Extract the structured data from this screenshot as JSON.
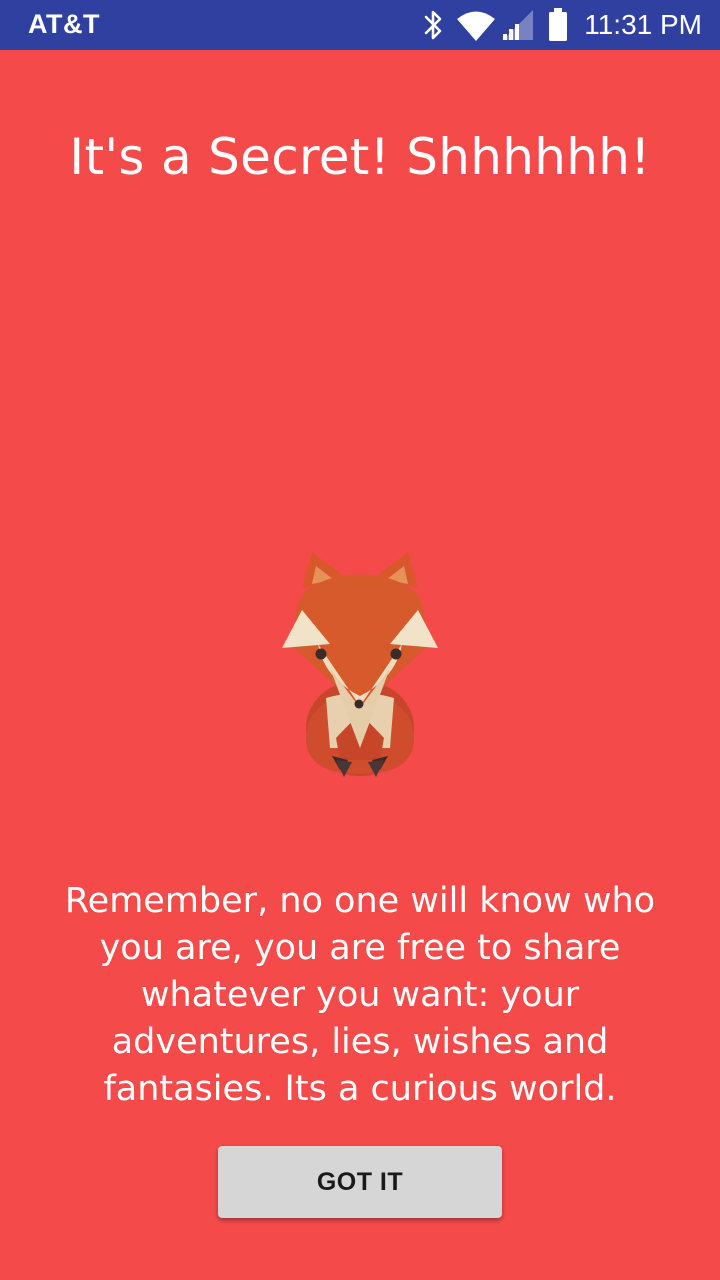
{
  "status_bar": {
    "carrier": "AT&T",
    "time": "11:31 PM",
    "icons": [
      "bluetooth-icon",
      "wifi-icon",
      "cellular-signal-icon",
      "battery-icon"
    ],
    "background_color": "#3040a0"
  },
  "screen": {
    "background_color": "#f44a4a",
    "title": "It's a Secret! Shhhhhh!",
    "illustration": "fox-illustration",
    "message": "Remember, no one will know who you are, you are free to share whatever you want: your adventures, lies, wishes and fantasies. Its a curious world.",
    "button_label": "GOT IT"
  }
}
